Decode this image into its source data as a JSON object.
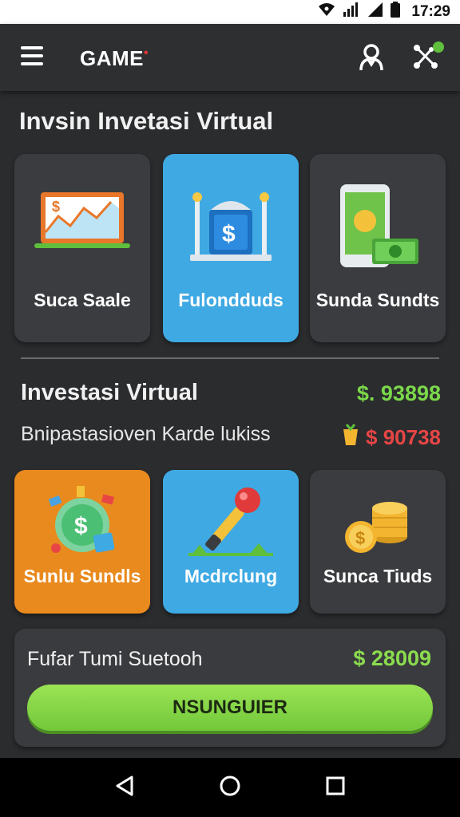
{
  "status_bar": {
    "time": "17:29"
  },
  "app_bar": {
    "title": "GAME",
    "title_mark": "•"
  },
  "section": {
    "title": "Invsin Invetasi Virtual",
    "cards": [
      {
        "label": "Suca Saale",
        "icon": "chart-board-icon",
        "color": "#3b3c3f"
      },
      {
        "label": "Fulondduds",
        "icon": "bank-dollar-icon",
        "color": "#3fa9e3"
      },
      {
        "label": "Sunda Sundts",
        "icon": "phone-cash-icon",
        "color": "#3b3c3f"
      }
    ]
  },
  "investasi": {
    "title": "Investasi Virtual",
    "amount": "$. 93898",
    "subtitle": "Bnipastasioven Karde lukiss",
    "sub_amount": "$ 90738"
  },
  "games": [
    {
      "label": "Sunlu Sundls",
      "icon": "money-globe-icon",
      "color": "#e98a1e"
    },
    {
      "label": "Mcdrclung",
      "icon": "joystick-icon",
      "color": "#3fa9e3"
    },
    {
      "label": "Sunca Tiuds",
      "icon": "coin-stack-icon",
      "color": "#3b3c3f"
    }
  ],
  "summary": {
    "label": "Fufar Tumi Suetooh",
    "amount": "$ 28009",
    "button": "NSUNGUIER"
  },
  "colors": {
    "accent_green": "#7bd84a",
    "accent_red": "#e84545",
    "accent_blue": "#3fa9e3",
    "accent_orange": "#e98a1e"
  }
}
